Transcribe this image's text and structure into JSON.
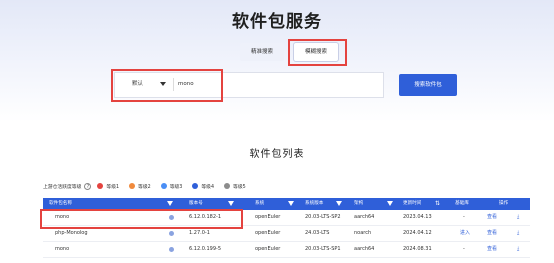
{
  "header": {
    "title": "软件包服务"
  },
  "tabs": [
    {
      "label": "精准搜索"
    },
    {
      "label": "模糊搜索"
    }
  ],
  "search": {
    "select_value": "默认",
    "query": "mono",
    "button_label": "搜索软件包"
  },
  "list": {
    "title": "软件包列表"
  },
  "legend": {
    "label": "上游仓活跃度等级",
    "levels": [
      {
        "label": "等级1",
        "color": "#e4433f"
      },
      {
        "label": "等级2",
        "color": "#f08a3c"
      },
      {
        "label": "等级3",
        "color": "#4a8ef5"
      },
      {
        "label": "等级4",
        "color": "#2f5fd9"
      },
      {
        "label": "等级5",
        "color": "#8c8c8c"
      }
    ]
  },
  "table": {
    "columns": [
      "软件包名称",
      "版本号",
      "系统",
      "系统版本",
      "架构",
      "更新时间",
      "基础库",
      "操作"
    ],
    "rows": [
      {
        "name": "mono",
        "version": "6.12.0.182-1",
        "os": "openEuler",
        "os_version": "20.03-LTS-SP2",
        "arch": "aarch64",
        "updated": "2023.04.13",
        "base": "-",
        "view": "查看",
        "download": "⤓"
      },
      {
        "name": "php-Monolog",
        "version": "1.27.0-1",
        "os": "openEuler",
        "os_version": "24.03-LTS",
        "arch": "noarch",
        "updated": "2024.04.12",
        "base": "进入",
        "view": "查看",
        "download": "⤓"
      },
      {
        "name": "mono",
        "version": "6.12.0.199-5",
        "os": "openEuler",
        "os_version": "20.03-LTS-SP1",
        "arch": "aarch64",
        "updated": "2024.08.31",
        "base": "-",
        "view": "查看",
        "download": "⤓"
      }
    ]
  }
}
